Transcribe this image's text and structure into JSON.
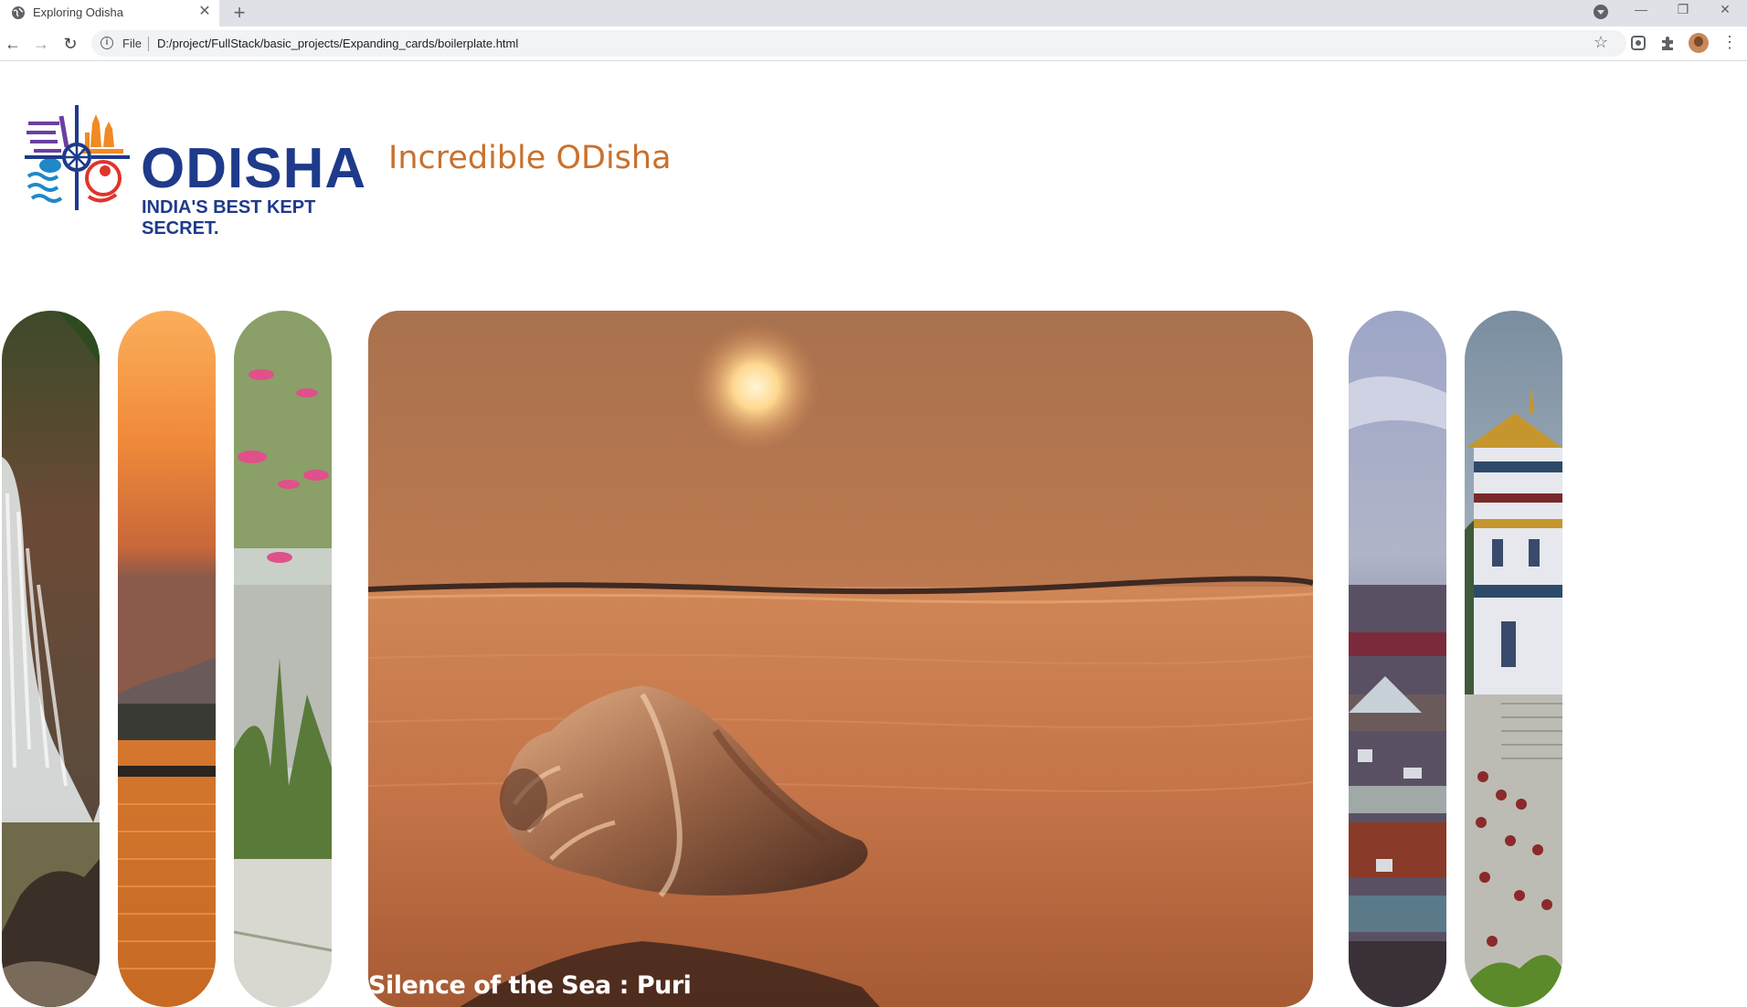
{
  "browser": {
    "tab_title": "Exploring Odisha",
    "file_label": "File",
    "url": "D:/project/FullStack/basic_projects/Expanding_cards/boilerplate.html"
  },
  "header": {
    "logo_word": "ODISHA",
    "logo_tagline": "INDIA'S BEST KEPT SECRET.",
    "heading": "Incredible ODisha"
  },
  "panels": [
    {
      "caption": "",
      "active": false,
      "scene": "waterfall"
    },
    {
      "caption": "",
      "active": false,
      "scene": "sunset-lake"
    },
    {
      "caption": "",
      "active": false,
      "scene": "lotus-lake"
    },
    {
      "caption": "Silence of the Sea : Puri",
      "active": true,
      "scene": "conch-beach"
    },
    {
      "caption": "",
      "active": false,
      "scene": "town-view"
    },
    {
      "caption": "",
      "active": false,
      "scene": "monastery"
    }
  ],
  "icons": [
    "globe-icon",
    "close-icon",
    "plus-icon",
    "tab-search-icon",
    "back-arrow-icon",
    "forward-arrow-icon",
    "reload-icon",
    "info-icon",
    "star-icon",
    "screen-capture-icon",
    "puzzle-icon",
    "avatar",
    "kebab-menu-icon"
  ],
  "colors": {
    "brand": "#1e3a8a",
    "heading": "#c8712e"
  }
}
